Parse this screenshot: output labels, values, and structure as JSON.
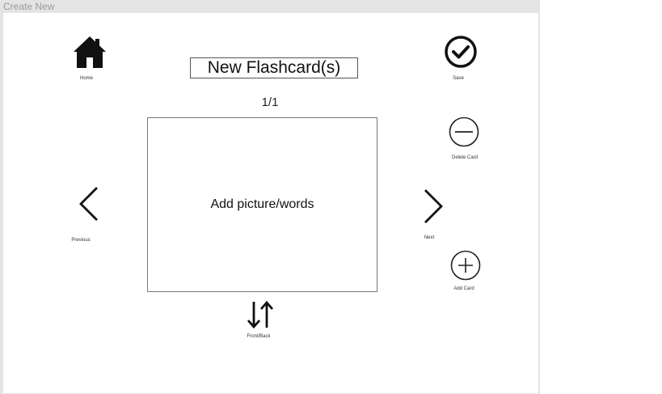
{
  "window": {
    "title": "Create New"
  },
  "header": {
    "deck_title": "New Flashcard(s)",
    "page_counter": "1/1"
  },
  "card": {
    "placeholder": "Add picture/words"
  },
  "buttons": {
    "home": "Home",
    "save": "Save",
    "delete_card": "Delete Card",
    "previous": "Previous",
    "next": "Next",
    "add_card": "Add Card",
    "flip": "Front/Back"
  },
  "icons": {
    "home": "home-icon",
    "save": "check-circle-icon",
    "delete_card": "minus-circle-icon",
    "previous": "chevron-left-icon",
    "next": "chevron-right-icon",
    "add_card": "plus-circle-icon",
    "flip": "swap-vertical-icon"
  },
  "colors": {
    "titlebar_bg": "#e4e4e4",
    "titlebar_text": "#9a9a9a",
    "icon": "#111111"
  }
}
